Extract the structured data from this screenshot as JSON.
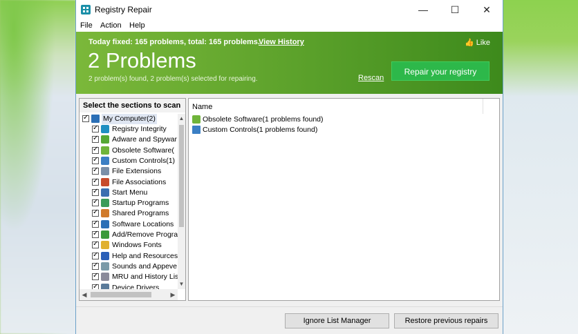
{
  "window": {
    "title": "Registry Repair",
    "controls": {
      "minimize": "—",
      "maximize": "☐",
      "close": "✕"
    }
  },
  "menu": [
    "File",
    "Action",
    "Help"
  ],
  "banner": {
    "today_fixed": "Today fixed: 165 problems, total: 165 problems.",
    "view_history": "View History",
    "like": "Like",
    "big_title": "2 Problems",
    "subtitle": "2 problem(s) found, 2 problem(s) selected for repairing.",
    "rescan": "Rescan",
    "repair_button": "Repair your registry"
  },
  "left_panel": {
    "header": "Select the sections to scan",
    "root": "My Computer(2)",
    "items": [
      {
        "label": "Registry Integrity",
        "icon": "registry-icon"
      },
      {
        "label": "Adware and Spywar",
        "icon": "adware-icon"
      },
      {
        "label": "Obsolete Software(",
        "icon": "trash-icon"
      },
      {
        "label": "Custom Controls(1)",
        "icon": "controls-icon"
      },
      {
        "label": "File Extensions",
        "icon": "file-icon"
      },
      {
        "label": "File Associations",
        "icon": "associations-icon"
      },
      {
        "label": "Start Menu",
        "icon": "start-menu-icon"
      },
      {
        "label": "Startup Programs",
        "icon": "startup-icon"
      },
      {
        "label": "Shared Programs",
        "icon": "shared-icon"
      },
      {
        "label": "Software Locations",
        "icon": "software-icon"
      },
      {
        "label": "Add/Remove Progra",
        "icon": "add-remove-icon"
      },
      {
        "label": "Windows Fonts",
        "icon": "fonts-icon"
      },
      {
        "label": "Help and Resources",
        "icon": "help-icon"
      },
      {
        "label": "Sounds and Appeve",
        "icon": "sounds-icon"
      },
      {
        "label": "MRU and History Lis",
        "icon": "history-icon"
      },
      {
        "label": "Device Drivers",
        "icon": "drivers-icon"
      }
    ]
  },
  "right_panel": {
    "column_name": "Name",
    "rows": [
      {
        "label": "Obsolete Software(1 problems found)",
        "icon": "trash-icon"
      },
      {
        "label": "Custom Controls(1 problems found)",
        "icon": "controls-icon"
      }
    ]
  },
  "buttons": {
    "ignore_list": "Ignore List Manager",
    "restore": "Restore previous repairs"
  },
  "colors": {
    "banner_left": "#7bb83a",
    "banner_right": "#3d8a1c",
    "repair_button": "#2db84a"
  }
}
